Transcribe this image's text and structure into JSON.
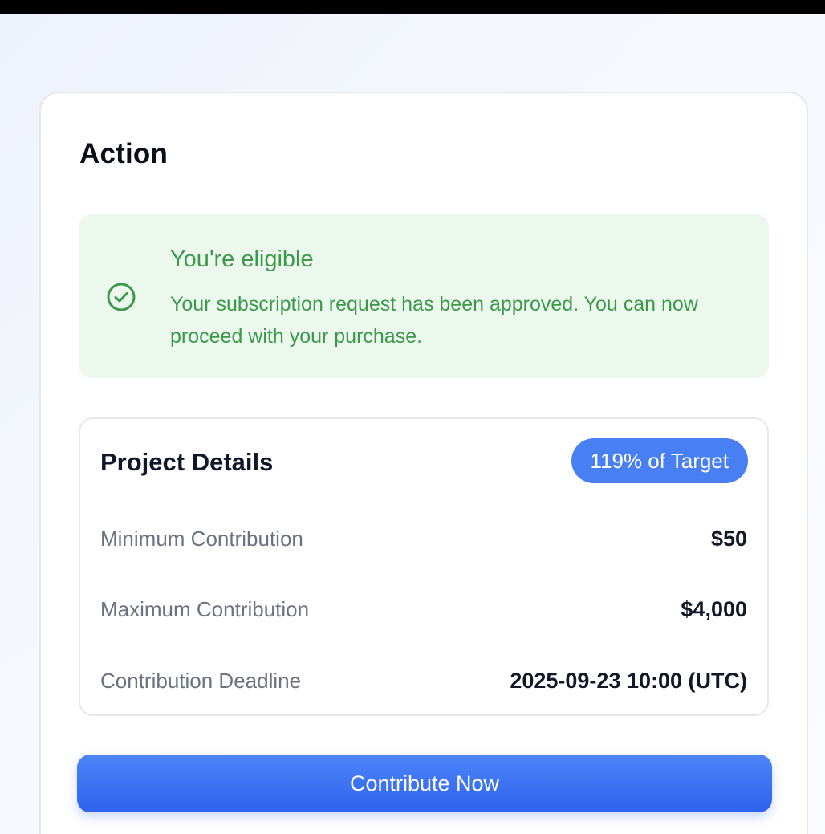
{
  "card": {
    "title": "Action"
  },
  "alert": {
    "icon": "check-circle-icon",
    "title": "You're eligible",
    "message": "Your subscription request has been approved. You can now proceed with your purchase.",
    "color": "#3b9a4a",
    "background": "#ecf7ee"
  },
  "details": {
    "title": "Project Details",
    "badge": "119% of Target",
    "rows": [
      {
        "label": "Minimum Contribution",
        "value": "$50"
      },
      {
        "label": "Maximum Contribution",
        "value": "$4,000"
      },
      {
        "label": "Contribution Deadline",
        "value": "2025-09-23 10:00 (UTC)"
      }
    ]
  },
  "actions": {
    "contribute_label": "Contribute Now",
    "accent": "#3a6ff3"
  }
}
